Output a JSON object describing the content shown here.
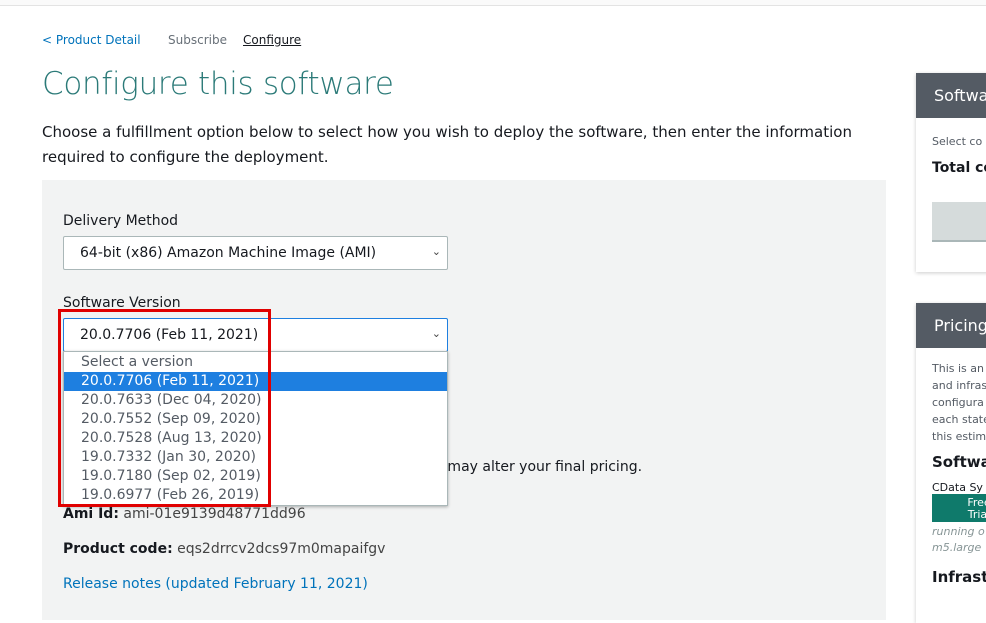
{
  "breadcrumb": {
    "back": "< Product Detail",
    "subscribe": "Subscribe",
    "configure": "Configure"
  },
  "title": "Configure this software",
  "description": "Choose a fulfillment option below to select how you wish to deploy the software, then enter the information required to configure the deployment.",
  "delivery": {
    "label": "Delivery Method",
    "value": "64-bit (x86) Amazon Machine Image (AMI)"
  },
  "version": {
    "label": "Software Version",
    "value": "20.0.7706 (Feb 11, 2021)",
    "options": [
      "Select a version",
      "20.0.7706 (Feb 11, 2021)",
      "20.0.7633 (Dec 04, 2020)",
      "20.0.7552 (Sep 09, 2020)",
      "20.0.7528 (Aug 13, 2020)",
      "19.0.7332 (Jan 30, 2020)",
      "19.0.7180 (Sep 02, 2019)",
      "19.0.6977 (Feb 26, 2019)"
    ]
  },
  "hidden_note": "ent may alter your final pricing.",
  "ami": {
    "label": "Ami Id:",
    "value": "ami-01e9139d48771dd96"
  },
  "product_code": {
    "label": "Product code:",
    "value": "eqs2drrcv2dcs97m0mapaifgv"
  },
  "release_notes": "Release notes (updated February 11, 2021)",
  "side": {
    "panel1": {
      "title": "Softwa",
      "line1": "Select co",
      "line2": "Total co"
    },
    "panel2": {
      "title": "Pricing",
      "lines": [
        "This is an",
        "and infras",
        "configura",
        "each state",
        "this estim"
      ],
      "software": "Softwa",
      "product": "CData Sy",
      "badge": "Free Trial",
      "running": "running o",
      "instance": "m5.large",
      "infra": "Infrastr"
    }
  },
  "colors": {
    "accent": "#2b7a78",
    "selected": "#1e7fe0",
    "highlight": "#e00000",
    "header": "#545b64"
  }
}
